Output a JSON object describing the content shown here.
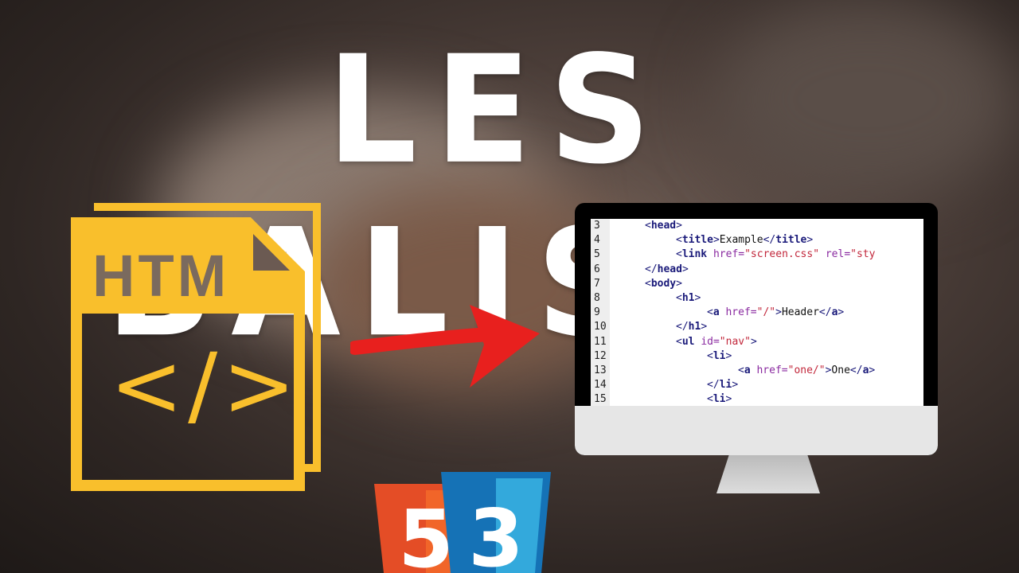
{
  "title": "LES BALISES",
  "file_icon": {
    "label": "HTM",
    "symbol": "</>",
    "color": "#f9bf2c"
  },
  "arrow_color": "#e8201e",
  "code_lines": [
    {
      "n": "3",
      "indent": 1,
      "tokens": [
        [
          "tag",
          "<"
        ],
        [
          "tagb",
          "head"
        ],
        [
          "tag",
          ">"
        ]
      ]
    },
    {
      "n": "4",
      "indent": 2,
      "tokens": [
        [
          "tag",
          "<"
        ],
        [
          "tagb",
          "title"
        ],
        [
          "tag",
          ">"
        ],
        [
          "text",
          "Example"
        ],
        [
          "tag",
          "</"
        ],
        [
          "tagb",
          "title"
        ],
        [
          "tag",
          ">"
        ]
      ]
    },
    {
      "n": "5",
      "indent": 2,
      "tokens": [
        [
          "tag",
          "<"
        ],
        [
          "tagb",
          "link"
        ],
        [
          "text",
          " "
        ],
        [
          "attr",
          "href="
        ],
        [
          "str",
          "\"screen.css\""
        ],
        [
          "text",
          " "
        ],
        [
          "attr",
          "rel="
        ],
        [
          "str",
          "\"sty"
        ]
      ]
    },
    {
      "n": "6",
      "indent": 1,
      "tokens": [
        [
          "tag",
          "</"
        ],
        [
          "tagb",
          "head"
        ],
        [
          "tag",
          ">"
        ]
      ]
    },
    {
      "n": "7",
      "indent": 1,
      "tokens": [
        [
          "tag",
          "<"
        ],
        [
          "tagb",
          "body"
        ],
        [
          "tag",
          ">"
        ]
      ]
    },
    {
      "n": "8",
      "indent": 2,
      "tokens": [
        [
          "tag",
          "<"
        ],
        [
          "tagb",
          "h1"
        ],
        [
          "tag",
          ">"
        ]
      ]
    },
    {
      "n": "9",
      "indent": 3,
      "tokens": [
        [
          "tag",
          "<"
        ],
        [
          "tagb",
          "a"
        ],
        [
          "text",
          " "
        ],
        [
          "attr",
          "href="
        ],
        [
          "str",
          "\"/\""
        ],
        [
          "tag",
          ">"
        ],
        [
          "text",
          "Header"
        ],
        [
          "tag",
          "</"
        ],
        [
          "tagb",
          "a"
        ],
        [
          "tag",
          ">"
        ]
      ]
    },
    {
      "n": "10",
      "indent": 2,
      "tokens": [
        [
          "tag",
          "</"
        ],
        [
          "tagb",
          "h1"
        ],
        [
          "tag",
          ">"
        ]
      ]
    },
    {
      "n": "11",
      "indent": 2,
      "tokens": [
        [
          "tag",
          "<"
        ],
        [
          "tagb",
          "ul"
        ],
        [
          "text",
          " "
        ],
        [
          "attr",
          "id="
        ],
        [
          "str",
          "\"nav\""
        ],
        [
          "tag",
          ">"
        ]
      ]
    },
    {
      "n": "12",
      "indent": 3,
      "tokens": [
        [
          "tag",
          "<"
        ],
        [
          "tagb",
          "li"
        ],
        [
          "tag",
          ">"
        ]
      ]
    },
    {
      "n": "13",
      "indent": 4,
      "tokens": [
        [
          "tag",
          "<"
        ],
        [
          "tagb",
          "a"
        ],
        [
          "text",
          " "
        ],
        [
          "attr",
          "href="
        ],
        [
          "str",
          "\"one/\""
        ],
        [
          "tag",
          ">"
        ],
        [
          "text",
          "One"
        ],
        [
          "tag",
          "</"
        ],
        [
          "tagb",
          "a"
        ],
        [
          "tag",
          ">"
        ]
      ]
    },
    {
      "n": "14",
      "indent": 3,
      "tokens": [
        [
          "tag",
          "</"
        ],
        [
          "tagb",
          "li"
        ],
        [
          "tag",
          ">"
        ]
      ]
    },
    {
      "n": "15",
      "indent": 3,
      "tokens": [
        [
          "tag",
          "<"
        ],
        [
          "tagb",
          "li"
        ],
        [
          "tag",
          ">"
        ]
      ]
    }
  ],
  "logos": {
    "html5": "5",
    "css3": "3"
  }
}
